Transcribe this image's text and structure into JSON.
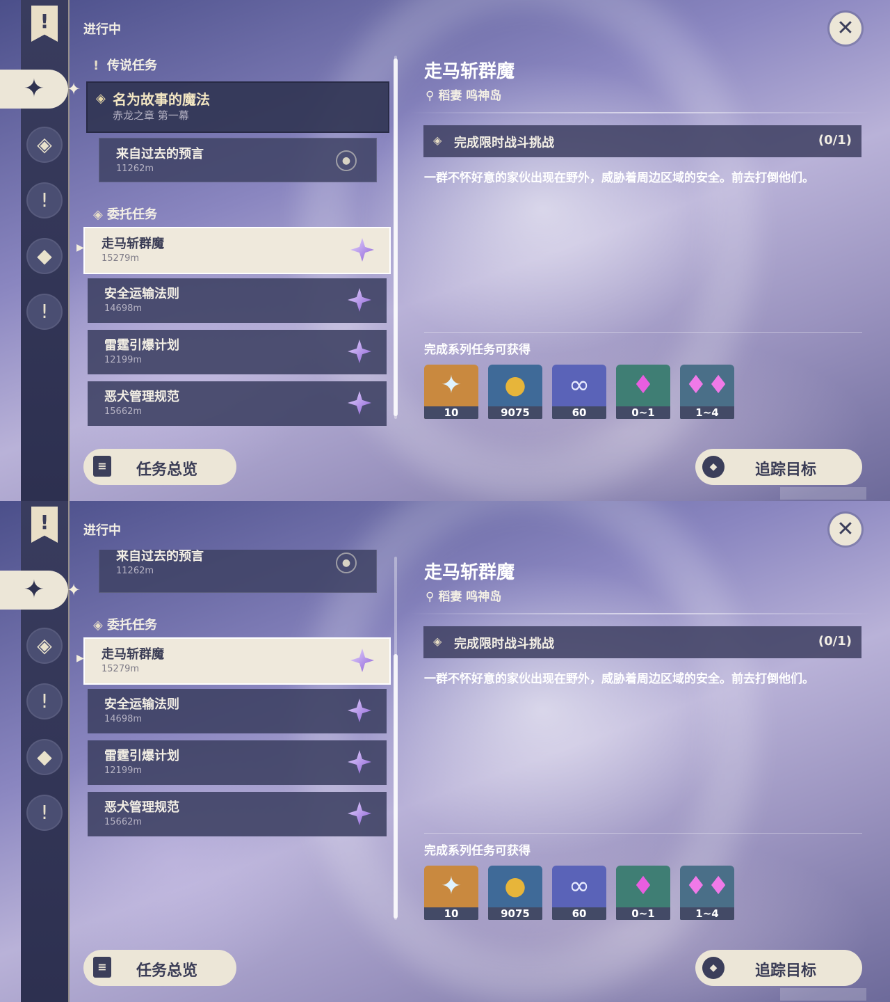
{
  "header": {
    "status_title": "进行中",
    "close_label": "✕"
  },
  "sidebar": {
    "banner_glyph": "!",
    "active_glyph": "✦",
    "btn1": "◈",
    "btn2": "!",
    "btn3": "◆",
    "btn4": "!"
  },
  "list": {
    "legend_label": "传说任务",
    "legend_quest": {
      "title": "名为故事的魔法",
      "chapter": "赤龙之章 第一幕"
    },
    "legend_sub": {
      "title": "来自过去的预言",
      "distance": "11262m"
    },
    "commission_label": "委托任务",
    "commissions": [
      {
        "title": "走马斩群魔",
        "distance": "15279m"
      },
      {
        "title": "安全运输法则",
        "distance": "14698m"
      },
      {
        "title": "雷霆引爆计划",
        "distance": "12199m"
      },
      {
        "title": "恶犬管理规范",
        "distance": "15662m"
      }
    ]
  },
  "detail": {
    "title": "走马斩群魔",
    "location": "稻妻 鸣神岛",
    "objective": "完成限时战斗挑战",
    "progress": "(0/1)",
    "description": "一群不怀好意的家伙出现在野外，威胁着周边区域的安全。前去打倒他们。",
    "rewards_title": "完成系列任务可获得",
    "rewards": [
      {
        "icon": "primogem-icon",
        "count": "10",
        "color": "#c9893f"
      },
      {
        "icon": "mora-icon",
        "count": "9075",
        "color": "#3f6a98"
      },
      {
        "icon": "companionship-icon",
        "count": "60",
        "color": "#5a63b8"
      },
      {
        "icon": "crystal-icon",
        "count": "0~1",
        "color": "#3f7e74"
      },
      {
        "icon": "crystal-cluster-icon",
        "count": "1~4",
        "color": "#3f7e74"
      }
    ]
  },
  "footer": {
    "overview_label": "任务总览",
    "track_label": "追踪目标"
  }
}
